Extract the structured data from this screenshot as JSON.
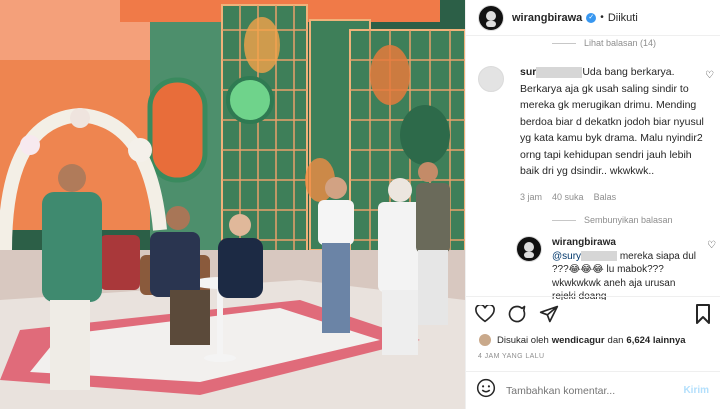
{
  "photo": {
    "description_icon": "tv-studio-photo",
    "colors": {
      "wall": "#2f6b4e",
      "orange": "#e86d3a",
      "floor": "#e06b7a"
    }
  },
  "header": {
    "username": "wirangbirawa",
    "separator": "•",
    "follow_label": "Diikuti"
  },
  "thread": {
    "view_replies_label": "Lihat balasan (14)",
    "comment": {
      "username_prefix": "sur",
      "text": "Uda bang berkarya. Berkarya aja gk usah saling sindir to mereka gk merugikan drimu. Mending berdoa biar d dekatkn jodoh biar nyusul yg kata kamu byk drama. Malu nyindir2 orng tapi kehidupan sendri jauh lebih baik dri yg dsindir.. wkwkwk..",
      "time": "3 jam",
      "likes": "40 suka",
      "reply": "Balas"
    },
    "hide_replies_label": "Sembunyikan balasan",
    "reply": {
      "username": "wirangbirawa",
      "mention": "@sury",
      "text": " mereka siapa dul ???😂😂😂 lu mabok??? wkwkwkwk aneh aja urusan rejeki doang"
    }
  },
  "likes": {
    "prefix": "Disukai oleh",
    "user": "wendicagur",
    "connector": "dan",
    "count": "6,624 lainnya"
  },
  "timestamp": "4 JAM YANG LALU",
  "add_comment": {
    "placeholder": "Tambahkan komentar...",
    "post_label": "Kirim"
  },
  "icons": {
    "like": "heart-icon",
    "comment": "comment-icon",
    "share": "paper-plane-icon",
    "save": "bookmark-icon"
  },
  "colors": {
    "link_blue": "#3897f0",
    "muted": "#8e8e8e",
    "post_disabled": "#b2dffc"
  }
}
